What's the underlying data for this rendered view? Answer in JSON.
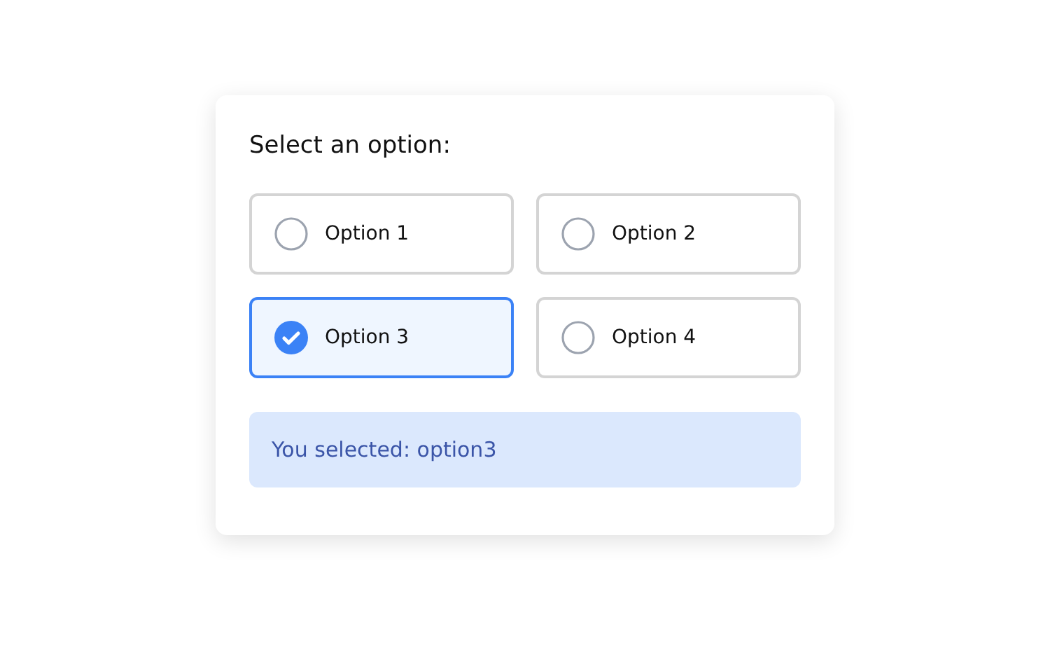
{
  "title": "Select an option:",
  "options": [
    {
      "label": "Option 1",
      "selected": false
    },
    {
      "label": "Option 2",
      "selected": false
    },
    {
      "label": "Option 3",
      "selected": true
    },
    {
      "label": "Option 4",
      "selected": false
    }
  ],
  "result": "You selected: option3"
}
